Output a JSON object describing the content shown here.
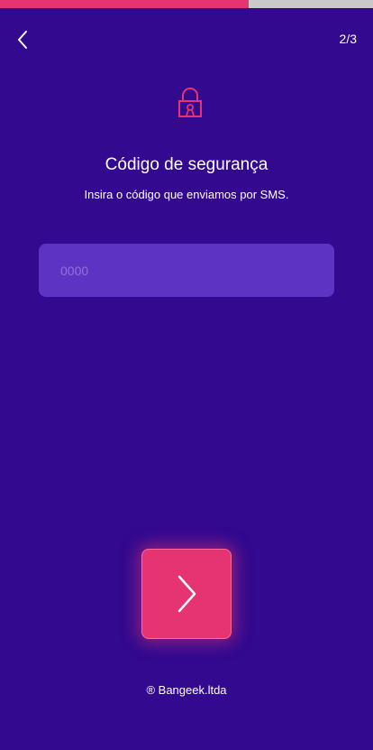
{
  "progress": {
    "value": 0.667,
    "fill_color": "#e63371",
    "track_color": "#c9c9c9"
  },
  "header": {
    "back_icon": "chevron-left-icon",
    "step": "2/3"
  },
  "main": {
    "icon": "lock-icon",
    "title": "Código de segurança",
    "subtitle": "Insira o código que enviamos por SMS.",
    "code_input": {
      "value": "",
      "placeholder": "0000"
    }
  },
  "actions": {
    "next_icon": "chevron-right-icon"
  },
  "footer": {
    "brand": "® Bangeek.ltda"
  },
  "colors": {
    "background": "#32098f",
    "accent": "#e63371",
    "input_background": "#5d33c4"
  }
}
